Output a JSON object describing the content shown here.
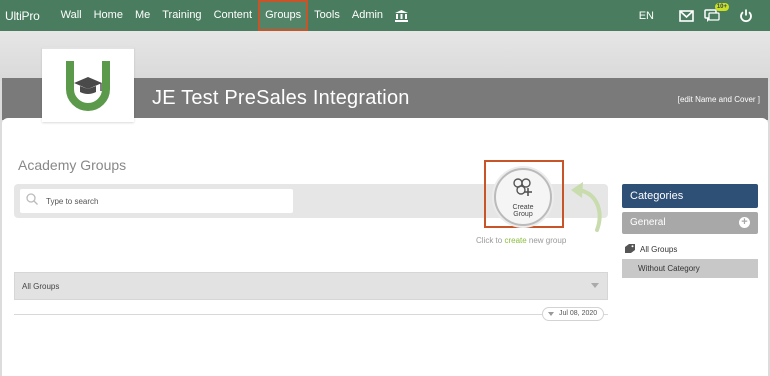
{
  "nav": {
    "logo": "UltiPro",
    "items": [
      {
        "label": "Wall"
      },
      {
        "label": "Home"
      },
      {
        "label": "Me"
      },
      {
        "label": "Training"
      },
      {
        "label": "Content"
      },
      {
        "label": "Groups",
        "active": true
      },
      {
        "label": "Tools"
      },
      {
        "label": "Admin"
      }
    ],
    "language": "EN",
    "chat_badge": "10+"
  },
  "cover": {
    "title": "JE Test PreSales Integration",
    "edit_link": "[edit Name and Cover ]"
  },
  "main": {
    "section_title": "Academy Groups",
    "search": {
      "placeholder": "Type to search"
    },
    "create": {
      "label_line1": "Create",
      "label_line2": "Group"
    },
    "hint": {
      "prefix": "Click to ",
      "link": "create",
      "suffix": " new group"
    },
    "filter": {
      "selected": "All Groups"
    },
    "timeline": {
      "date": "Jul 08, 2020"
    }
  },
  "sidebar": {
    "header": "Categories",
    "general": "General",
    "all_groups": "All Groups",
    "without_category": "Without Category"
  },
  "colors": {
    "nav_bg": "#4a7d5f",
    "active_outline": "#c8552a",
    "categories_bg": "#2e4f76",
    "accent_green": "#8bbd3c"
  },
  "icons": {
    "institution": "bank-icon",
    "mail": "mail-icon",
    "chat": "chat-icon",
    "power": "power-icon",
    "search": "search-icon",
    "create": "create-group-icon",
    "plus": "plus-circle-icon",
    "tag": "tag-icon"
  }
}
